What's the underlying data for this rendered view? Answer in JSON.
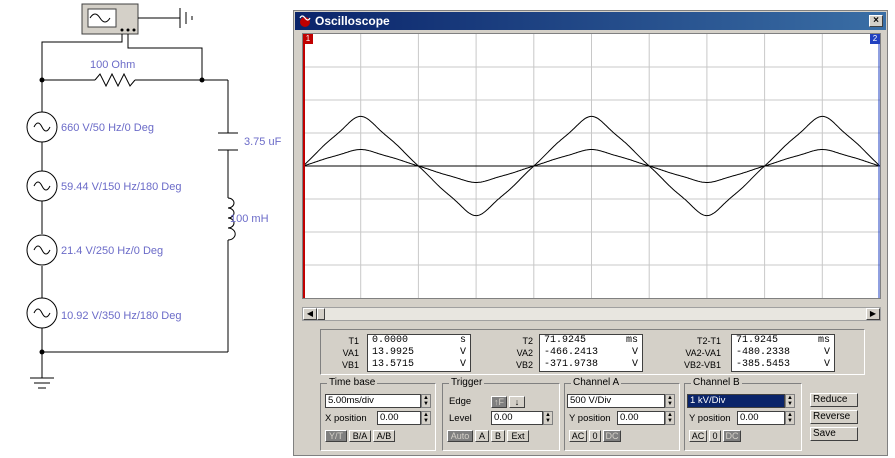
{
  "window": {
    "title": "Oscilloscope"
  },
  "circuit": {
    "resistor_label": "100  Ohm",
    "capacitor_label": "3.75 uF",
    "inductor_label": "100 mH",
    "sources": [
      "660 V/50 Hz/0 Deg",
      "59.44 V/150 Hz/180 Deg",
      "21.4 V/250 Hz/0 Deg",
      "10.92 V/350 Hz/180 Deg"
    ]
  },
  "cursors": {
    "c1": "1",
    "c2": "2"
  },
  "readouts": {
    "t1": {
      "labels": [
        "T1",
        "VA1",
        "VB1"
      ],
      "values": [
        "0.0000",
        "13.9925",
        "13.5715"
      ],
      "units": [
        "s",
        "V",
        "V"
      ]
    },
    "t2": {
      "labels": [
        "T2",
        "VA2",
        "VB2"
      ],
      "values": [
        "71.9245",
        "-466.2413",
        "-371.9738"
      ],
      "units": [
        "ms",
        "V",
        "V"
      ]
    },
    "dt": {
      "labels": [
        "T2-T1",
        "VA2-VA1",
        "VB2-VB1"
      ],
      "values": [
        "71.9245",
        "-480.2338",
        "-385.5453"
      ],
      "units": [
        "ms",
        "V",
        "V"
      ]
    }
  },
  "timebase": {
    "title": "Time base",
    "scale": "5.00ms/div",
    "xpos_label": "X position",
    "xpos": "0.00",
    "modes": [
      "Y/T",
      "B/A",
      "A/B"
    ]
  },
  "trigger": {
    "title": "Trigger",
    "edge_label": "Edge",
    "level_label": "Level",
    "level": "0.00",
    "edge_rise": "↑F",
    "edge_fall": "↓",
    "sources": [
      "Auto",
      "A",
      "B",
      "Ext"
    ]
  },
  "channel_a": {
    "title": "Channel A",
    "scale": "500  V/Div",
    "ypos_label": "Y position",
    "ypos": "0.00",
    "coupling": [
      "AC",
      "0",
      "DC"
    ]
  },
  "channel_b": {
    "title": "Channel B",
    "scale": "1  kV/Div",
    "ypos_label": "Y position",
    "ypos": "0.00",
    "coupling": [
      "AC",
      "0",
      "DC"
    ]
  },
  "side_buttons": [
    "Reduce",
    "Reverse",
    "Save"
  ],
  "traces": {
    "period_ms": 20,
    "time_per_div_ms": 5,
    "channel_a": {
      "v_per_div": 500,
      "harmonics": [
        [
          660,
          1,
          0
        ],
        [
          59.44,
          3,
          180
        ],
        [
          21.4,
          5,
          0
        ],
        [
          10.92,
          7,
          180
        ]
      ]
    },
    "channel_b_peak_v": 2000
  }
}
